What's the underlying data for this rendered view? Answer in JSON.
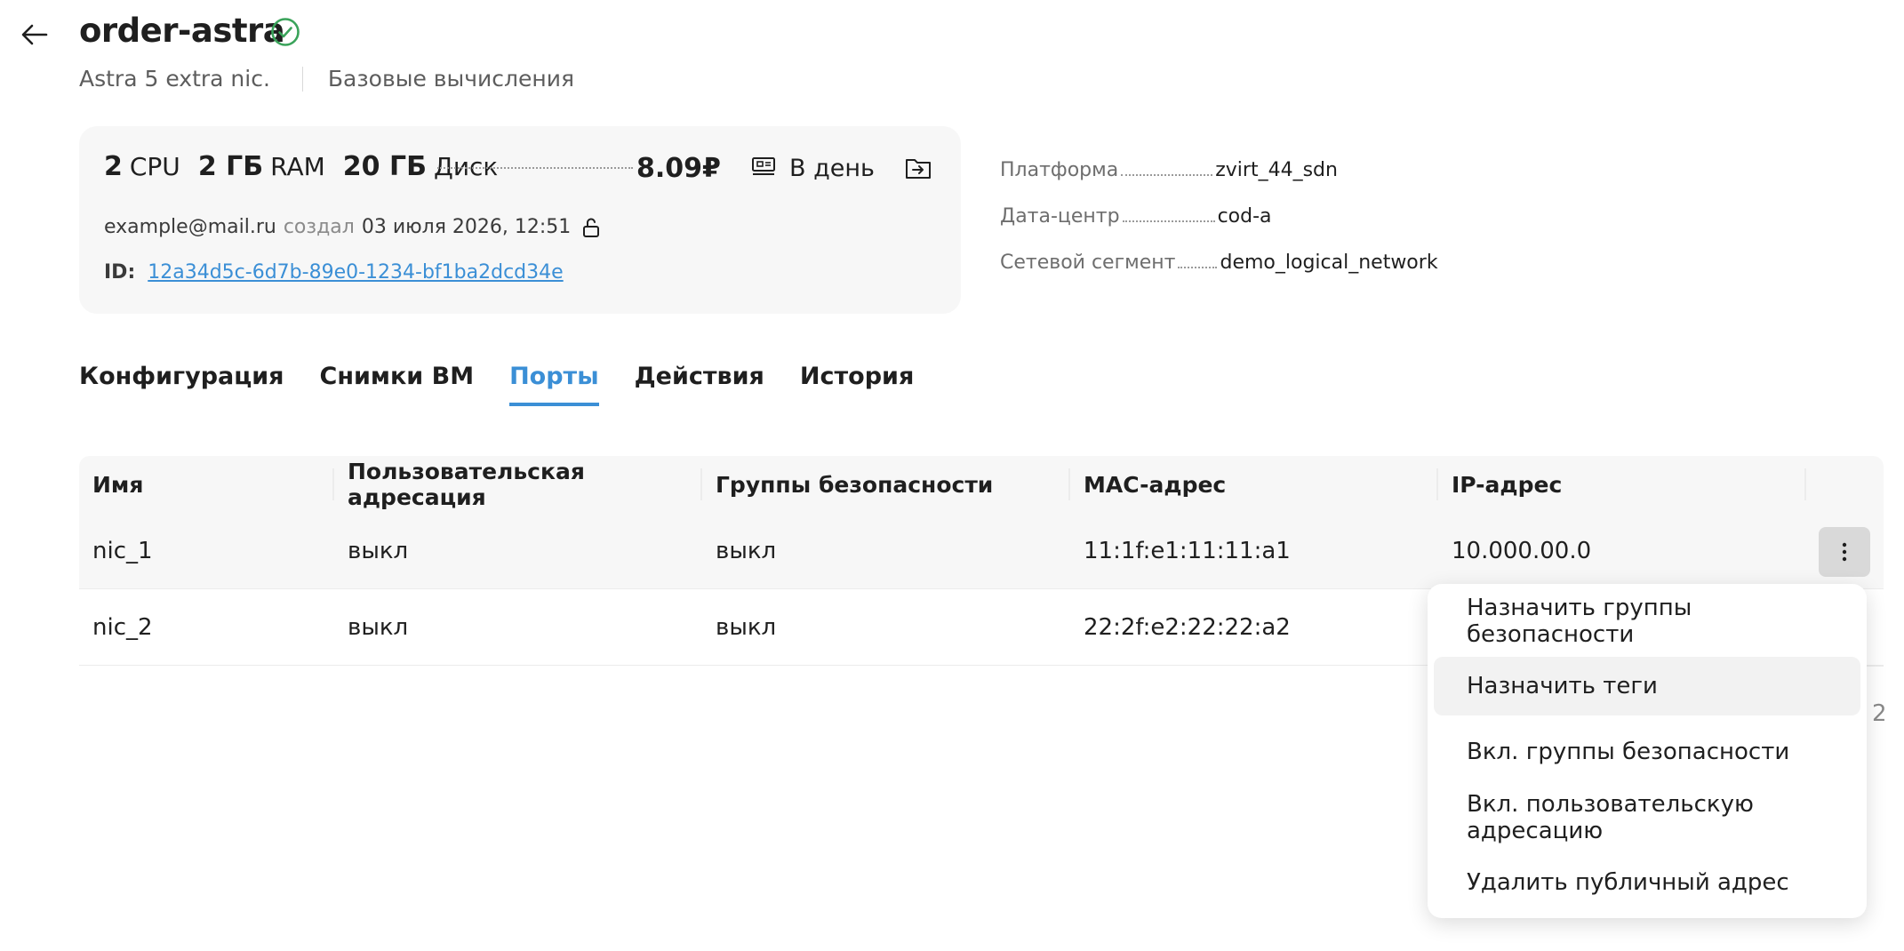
{
  "header": {
    "title": "order-astra",
    "subtitle_left": "Astra 5 extra nic.",
    "subtitle_right": "Базовые вычисления"
  },
  "summary": {
    "cpu_value": "2",
    "cpu_unit": "CPU",
    "ram_value": "2 ГБ",
    "ram_unit": "RAM",
    "disk_value": "20 ГБ",
    "disk_unit": "Диск",
    "price": "8.09₽",
    "period": "В день",
    "creator": "example@mail.ru",
    "created_word": "создал",
    "created_date": "03 июля 2026, 12:51",
    "id_label": "ID:",
    "id_value": "12a34d5c-6d7b-89e0-1234-bf1ba2dcd34e"
  },
  "properties": [
    {
      "key": "Платформа",
      "value": "zvirt_44_sdn"
    },
    {
      "key": "Дата-центр",
      "value": "cod-a"
    },
    {
      "key": "Сетевой сегмент",
      "value": "demo_logical_network"
    }
  ],
  "tabs": [
    {
      "label": "Конфигурация",
      "active": false
    },
    {
      "label": "Снимки ВМ",
      "active": false
    },
    {
      "label": "Порты",
      "active": true
    },
    {
      "label": "Действия",
      "active": false
    },
    {
      "label": "История",
      "active": false
    }
  ],
  "table": {
    "columns": [
      "Имя",
      "Пользовательская адресация",
      "Группы безопасности",
      "MAC-адрес",
      "IP-адрес"
    ],
    "rows": [
      {
        "name": "nic_1",
        "custom_addressing": "выкл",
        "security_groups": "выкл",
        "mac": "11:1f:e1:11:11:a1",
        "ip": "10.000.00.0"
      },
      {
        "name": "nic_2",
        "custom_addressing": "выкл",
        "security_groups": "выкл",
        "mac": "22:2f:e2:22:22:a2",
        "ip": ""
      }
    ]
  },
  "context_menu": {
    "items": [
      {
        "label": "Назначить группы безопасности"
      },
      {
        "label": "Назначить теги"
      },
      {
        "label": "Вкл. группы безопасности"
      },
      {
        "label": "Вкл. пользовательскую адресацию"
      },
      {
        "label": "Удалить публичный адрес"
      }
    ]
  },
  "pager_peek": "2",
  "colors": {
    "accent": "#3b8fd6",
    "success": "#3aa35a",
    "card_bg": "#f7f7f7"
  }
}
